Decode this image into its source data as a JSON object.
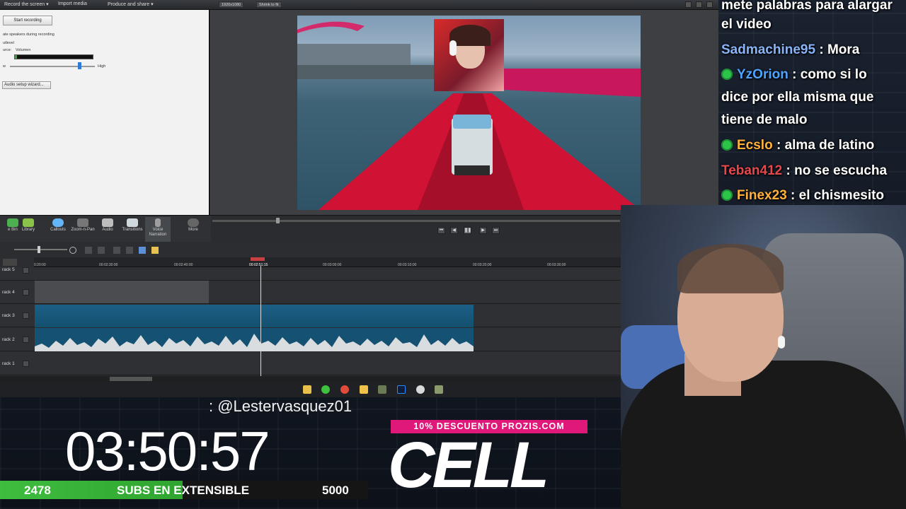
{
  "camtasia": {
    "menu": {
      "record": "Record the screen ▾",
      "import": "Import media",
      "produce": "Produce and share ▾"
    },
    "preview_toolbar": {
      "resolution": "1920x1080",
      "shrink": "Shrink to fit"
    },
    "record_panel": {
      "start_button": "Start recording",
      "speakers_checkbox": "ate speakers during recording",
      "input_level": "utlevel",
      "source_label": "urce:",
      "source_value": "Volumen",
      "low_label": "w",
      "high_label": "High",
      "setup_button": "Audio setup wizard..."
    },
    "tools": [
      {
        "label": "e Bin",
        "icon": "clip-bin-icon",
        "color": "#4caf50"
      },
      {
        "label": "Library",
        "icon": "library-icon",
        "color": "#8bc34a"
      },
      {
        "label": "Callouts",
        "icon": "callouts-icon",
        "color": "#64b5f6"
      },
      {
        "label": "Zoom-n-Pan",
        "icon": "zoom-icon",
        "color": "#9e9e9e"
      },
      {
        "label": "Audio",
        "icon": "audio-icon",
        "color": "#bdbdbd"
      },
      {
        "label": "Transitions",
        "icon": "transitions-icon",
        "color": "#cfd8dc"
      },
      {
        "label": "Voice Narration",
        "icon": "microphone-icon",
        "color": "#9e9e9e"
      },
      {
        "label": "More",
        "icon": "more-icon",
        "color": "#9e9e9e"
      }
    ],
    "ruler": {
      "ticks": [
        "0:20:00",
        "00:02:30:00",
        "00:02:40:00",
        "00:02:51;15",
        "00:03:00;00",
        "00:03:10;00",
        "00:03:20;00",
        "00:03:30;00"
      ]
    },
    "tracks": [
      {
        "label": "rack 5"
      },
      {
        "label": "rack 4"
      },
      {
        "label": "rack 3"
      },
      {
        "label": "rack 2"
      },
      {
        "label": "rack 1"
      }
    ]
  },
  "chat": {
    "messages": [
      {
        "user": "",
        "text": "mete palabras para alargar",
        "color": "#ffffff",
        "badge": false
      },
      {
        "user": "",
        "text": "el video",
        "color": "#ffffff",
        "badge": false
      },
      {
        "user": "Sadmachine95",
        "text": " : Mora",
        "color": "#8ab4f8",
        "badge": false
      },
      {
        "user": "YzOrion",
        "text": " : como si lo",
        "color": "#4ea3ff",
        "badge": true
      },
      {
        "user": "",
        "text": "dice por ella misma que",
        "color": "#ffffff",
        "badge": false
      },
      {
        "user": "",
        "text": "tiene de malo",
        "color": "#ffffff",
        "badge": false
      },
      {
        "user": "Ecslo",
        "text": " : alma de latino",
        "color": "#ffb13b",
        "badge": true
      },
      {
        "user": "Teban412",
        "text": " : no se escucha",
        "color": "#e5484d",
        "badge": false
      },
      {
        "user": "Finex23",
        "text": " : el chismesito",
        "color": "#ffb13b",
        "badge": true
      }
    ]
  },
  "overlay": {
    "handle": ": @Lestervasquez01",
    "timer": "03:50:57",
    "subs": {
      "count": "2478",
      "label": "SUBS EN EXTENSIBLE",
      "goal": "5000",
      "progress": 0.4956
    },
    "promo": "10% DESCUENTO PROZIS.COM",
    "brand": "CELL"
  }
}
